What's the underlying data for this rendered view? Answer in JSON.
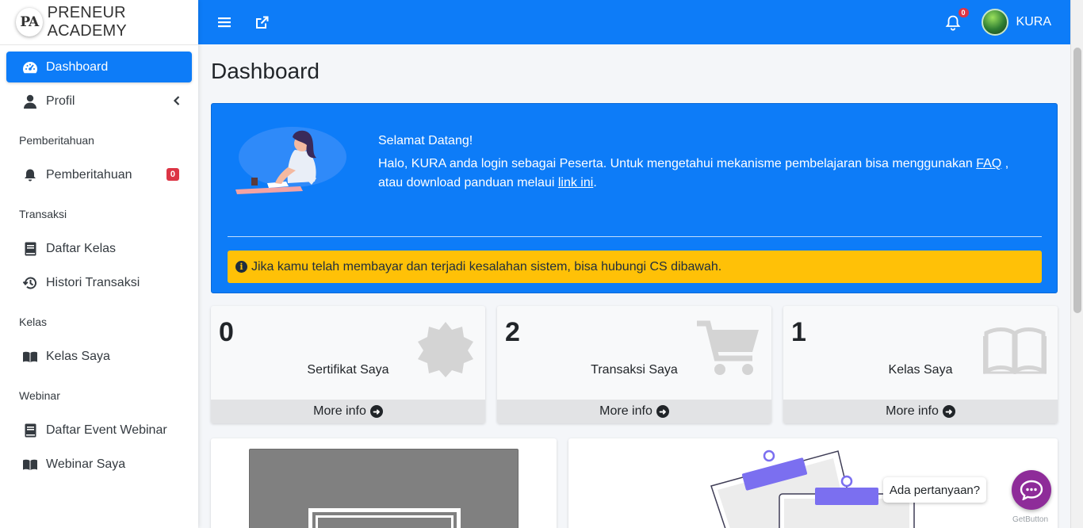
{
  "brand": {
    "logo_text": "PA",
    "name": "PRENEUR ACADEMY"
  },
  "sidebar": {
    "items": [
      {
        "label": "Dashboard",
        "icon": "tachometer-icon",
        "active": true
      },
      {
        "label": "Profil",
        "icon": "user-icon",
        "has_submenu": true
      }
    ],
    "sections": [
      {
        "header": "Pemberitahuan",
        "items": [
          {
            "label": "Pemberitahuan",
            "icon": "bell-icon",
            "badge": "0"
          }
        ]
      },
      {
        "header": "Transaksi",
        "items": [
          {
            "label": "Daftar Kelas",
            "icon": "book-icon"
          },
          {
            "label": "Histori Transaksi",
            "icon": "history-icon"
          }
        ]
      },
      {
        "header": "Kelas",
        "items": [
          {
            "label": "Kelas Saya",
            "icon": "open-book-icon"
          }
        ]
      },
      {
        "header": "Webinar",
        "items": [
          {
            "label": "Daftar Event Webinar",
            "icon": "book-icon"
          },
          {
            "label": "Webinar Saya",
            "icon": "open-book-icon"
          }
        ]
      }
    ]
  },
  "topbar": {
    "notification_count": "0",
    "username": "KURA",
    "accent": "#0d7cf8"
  },
  "main": {
    "title": "Dashboard",
    "welcome": {
      "greeting": "Selamat Datang!",
      "text_1": "Halo, KURA anda login sebagai Peserta. Untuk mengetahui mekanisme pembelajaran bisa menggunakan ",
      "faq_link": "FAQ",
      "text_2": " , atau download panduan melaui ",
      "guide_link": "link ini",
      "text_3": ".",
      "alert": "Jika kamu telah membayar dan terjadi kesalahan sistem, bisa hubungi CS dibawah."
    },
    "stats": [
      {
        "value": "0",
        "label": "Sertifikat Saya",
        "more": "More info",
        "icon": "certificate-icon"
      },
      {
        "value": "2",
        "label": "Transaksi Saya",
        "more": "More info",
        "icon": "cart-icon"
      },
      {
        "value": "1",
        "label": "Kelas Saya",
        "more": "More info",
        "icon": "open-book-icon"
      }
    ]
  },
  "chat": {
    "bubble": "Ada pertanyaan?",
    "brand": "GetButton",
    "color": "#8e2c99"
  }
}
